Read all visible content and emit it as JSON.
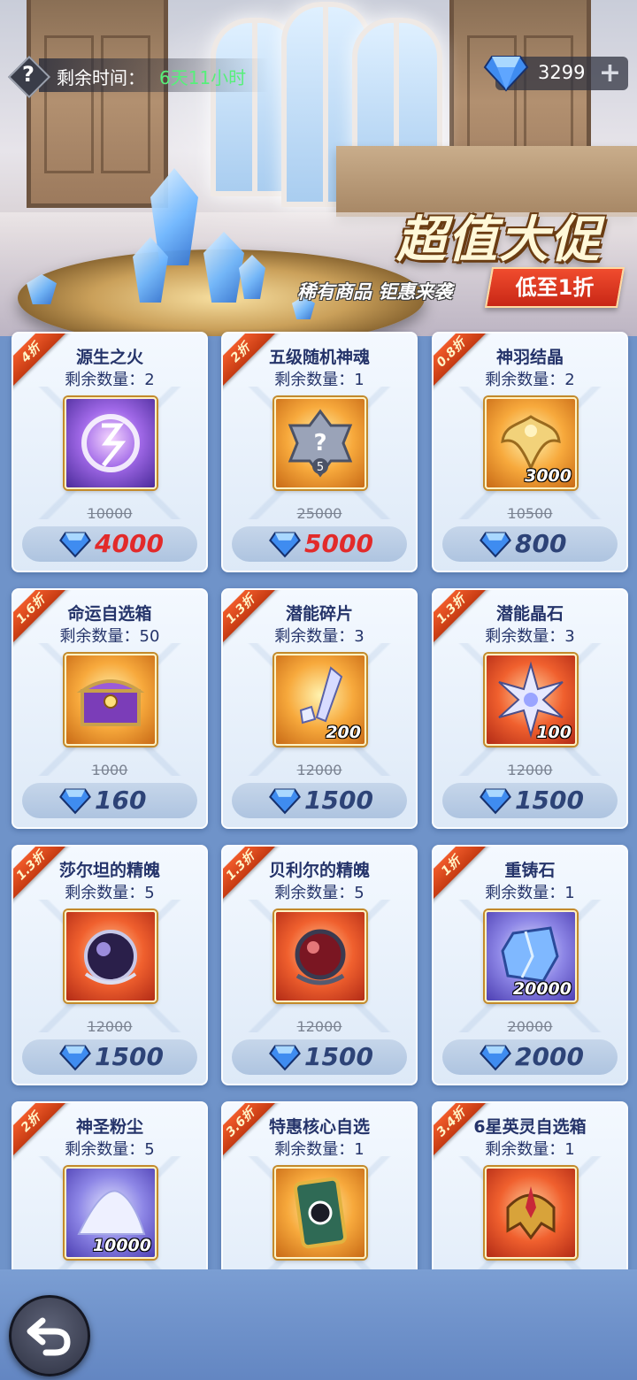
{
  "hud": {
    "help_icon": "question-icon",
    "remaining_label": "剩余时间：",
    "remaining_value": "6天11小时",
    "gem_count": "3299",
    "plus_label": "+"
  },
  "promo": {
    "title": "超值大促",
    "subtitle": "稀有商品 钜惠来袭",
    "tag": "低至1折"
  },
  "colors": {
    "discount_ribbon": "#d9481c",
    "sale_price_red": "#e22a2a",
    "price_blue": "#2d4377",
    "time_green": "#56f07a"
  },
  "shop": {
    "items": [
      {
        "discount": "4折",
        "name": "源生之火",
        "stock": "剩余数量：2",
        "icon": "fire-rune-orb",
        "quantity": "",
        "original_price": "10000",
        "price": "4000",
        "price_red": true
      },
      {
        "discount": "2折",
        "name": "五级随机神魂",
        "stock": "剩余数量：1",
        "icon": "mystery-soul-badge",
        "quantity": "",
        "original_price": "25000",
        "price": "5000",
        "price_red": true
      },
      {
        "discount": "0.8折",
        "name": "神羽结晶",
        "stock": "剩余数量：2",
        "icon": "golden-feather-crest",
        "quantity": "3000",
        "original_price": "10500",
        "price": "800",
        "price_red": false
      },
      {
        "discount": "1.6折",
        "name": "命运自选箱",
        "stock": "剩余数量：50",
        "icon": "treasure-chest",
        "quantity": "",
        "original_price": "1000",
        "price": "160",
        "price_red": false
      },
      {
        "discount": "1.3折",
        "name": "潜能碎片",
        "stock": "剩余数量：3",
        "icon": "crystal-shard",
        "quantity": "200",
        "original_price": "12000",
        "price": "1500",
        "price_red": false
      },
      {
        "discount": "1.3折",
        "name": "潜能晶石",
        "stock": "剩余数量：3",
        "icon": "star-crystal",
        "quantity": "100",
        "original_price": "12000",
        "price": "1500",
        "price_red": false
      },
      {
        "discount": "1.3折",
        "name": "莎尔坦的精魄",
        "stock": "剩余数量：5",
        "icon": "dark-spirit-orb",
        "quantity": "",
        "original_price": "12000",
        "price": "1500",
        "price_red": false
      },
      {
        "discount": "1.3折",
        "name": "贝利尔的精魄",
        "stock": "剩余数量：5",
        "icon": "red-spirit-orb",
        "quantity": "",
        "original_price": "12000",
        "price": "1500",
        "price_red": false
      },
      {
        "discount": "1折",
        "name": "重铸石",
        "stock": "剩余数量：1",
        "icon": "reforge-stone",
        "quantity": "20000",
        "original_price": "20000",
        "price": "2000",
        "price_red": false
      },
      {
        "discount": "2折",
        "name": "神圣粉尘",
        "stock": "剩余数量：5",
        "icon": "holy-dust",
        "quantity": "10000",
        "original_price": "",
        "price": "",
        "price_red": false
      },
      {
        "discount": "3.6折",
        "name": "特惠核心自选",
        "stock": "剩余数量：1",
        "icon": "core-card",
        "quantity": "",
        "original_price": "",
        "price": "",
        "price_red": false
      },
      {
        "discount": "3.4折",
        "name": "6星英灵自选箱",
        "stock": "剩余数量：1",
        "icon": "hero-helmet",
        "quantity": "",
        "original_price": "",
        "price": "",
        "price_red": false
      }
    ]
  },
  "nav": {
    "back_icon": "back-arrow-icon"
  }
}
